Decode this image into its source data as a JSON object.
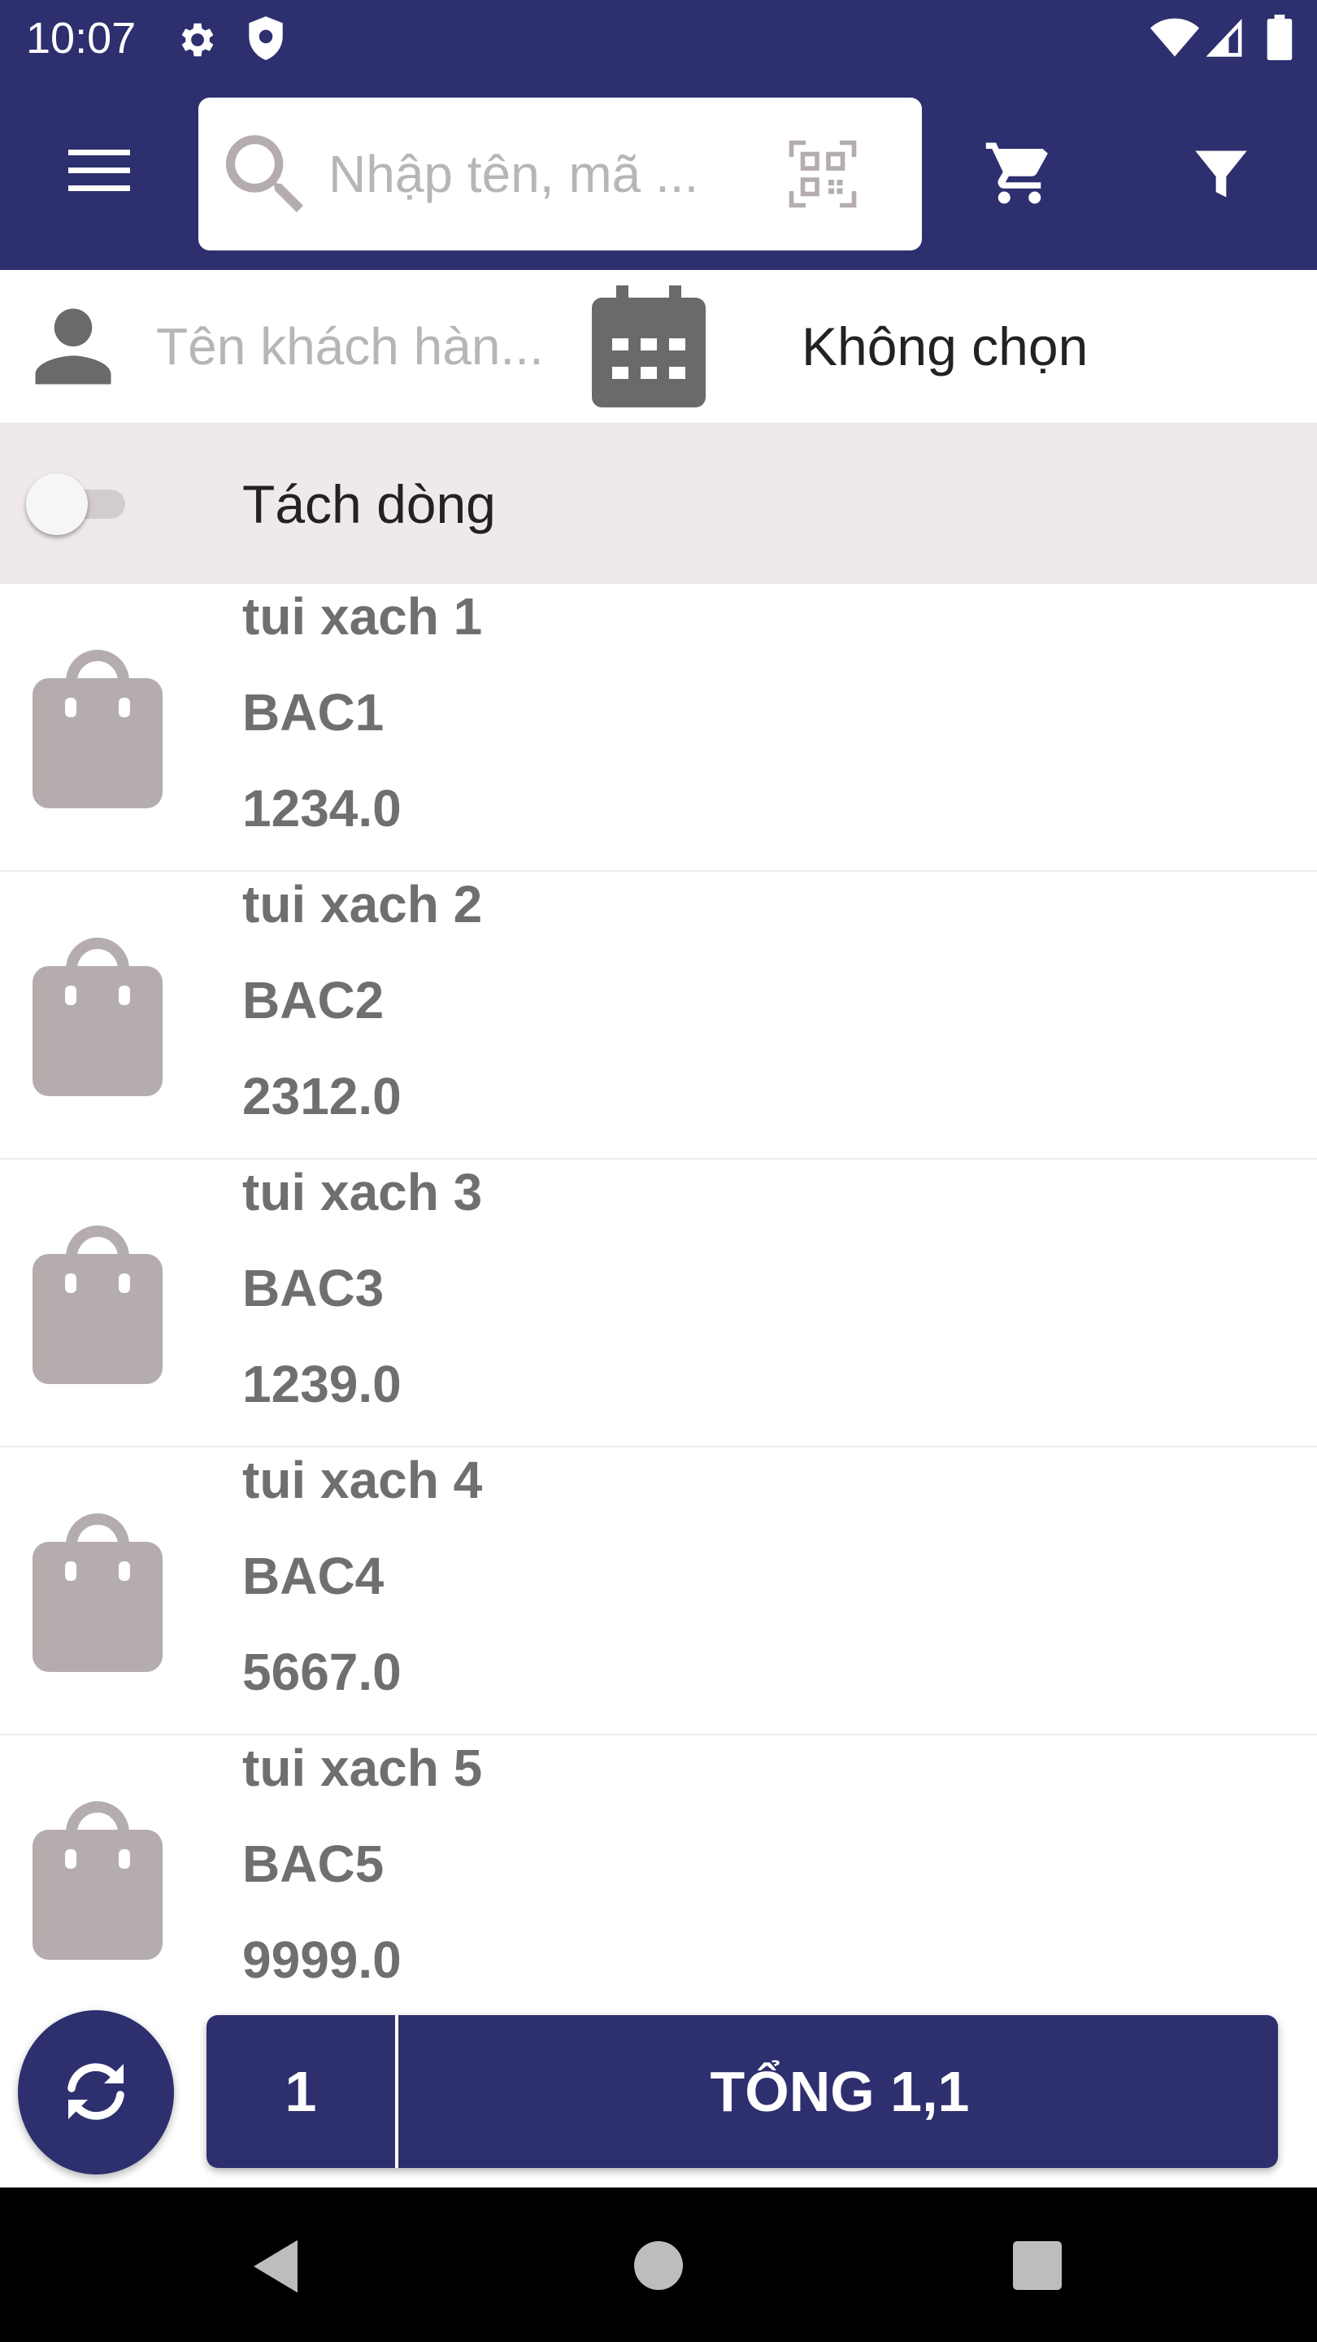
{
  "status_bar": {
    "time": "10:07",
    "icons": [
      "gear-icon",
      "shield-icon",
      "wifi-icon",
      "signal-icon",
      "battery-icon"
    ]
  },
  "toolbar": {
    "menu_icon": "menu-icon",
    "search_placeholder": "Nhập tên, mã ...",
    "search_icon": "search-icon",
    "scan_icon": "qr-code-icon",
    "cart_icon": "cart-icon",
    "filter_icon": "filter-icon"
  },
  "customer": {
    "placeholder": "Tên khách hàn...",
    "icon": "person-icon",
    "calendar_icon": "calendar-icon",
    "date_value": "Không chọn"
  },
  "split_line": {
    "label": "Tách dòng",
    "enabled": false
  },
  "products": [
    {
      "name": "tui xach 1",
      "code": "BAC1",
      "price": "1234.0",
      "icon": "shopping-bag-icon"
    },
    {
      "name": "tui xach 2",
      "code": "BAC2",
      "price": "2312.0",
      "icon": "shopping-bag-icon"
    },
    {
      "name": "tui xach 3",
      "code": "BAC3",
      "price": "1239.0",
      "icon": "shopping-bag-icon"
    },
    {
      "name": "tui xach 4",
      "code": "BAC4",
      "price": "5667.0",
      "icon": "shopping-bag-icon"
    },
    {
      "name": "tui xach 5",
      "code": "BAC5",
      "price": "9999.0",
      "icon": "shopping-bag-icon"
    }
  ],
  "bottom_bar": {
    "refresh_icon": "refresh-icon",
    "quantity": "1",
    "total_label": "TỔNG 1,1"
  },
  "nav_bar": {
    "icons": [
      "back-icon",
      "home-icon",
      "recent-apps-icon"
    ]
  },
  "colors": {
    "primary": "#2e2f6e",
    "toggle_row_bg": "#efe9e9",
    "product_text": "#6f6f6f",
    "icon_gray": "#b5adad"
  }
}
